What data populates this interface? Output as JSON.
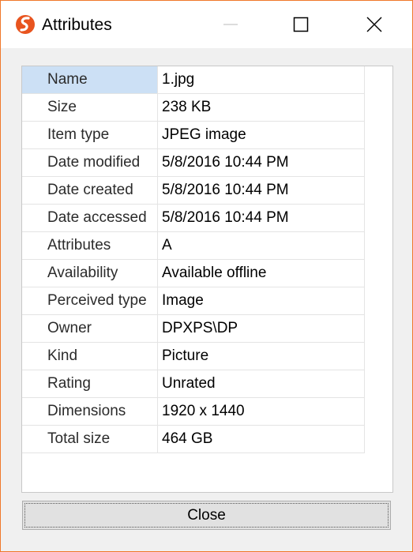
{
  "window": {
    "title": "Attributes",
    "accent": "#f0782a",
    "icons": {
      "app": "app-logo-icon",
      "minimize": "minimize-icon",
      "maximize": "maximize-icon",
      "close": "close-icon"
    }
  },
  "properties": {
    "rows": [
      {
        "name": "Name",
        "value": "1.jpg",
        "selected": true
      },
      {
        "name": "Size",
        "value": "238 KB"
      },
      {
        "name": "Item type",
        "value": "JPEG image"
      },
      {
        "name": "Date modified",
        "value": "5/8/2016 10:44 PM"
      },
      {
        "name": "Date created",
        "value": "5/8/2016 10:44 PM"
      },
      {
        "name": "Date accessed",
        "value": "5/8/2016 10:44 PM"
      },
      {
        "name": "Attributes",
        "value": "A"
      },
      {
        "name": "Availability",
        "value": "Available offline"
      },
      {
        "name": "Perceived type",
        "value": "Image"
      },
      {
        "name": "Owner",
        "value": "DPXPS\\DP"
      },
      {
        "name": "Kind",
        "value": "Picture"
      },
      {
        "name": "Rating",
        "value": "Unrated"
      },
      {
        "name": "Dimensions",
        "value": "1920 x 1440"
      },
      {
        "name": "Total size",
        "value": "464 GB"
      }
    ]
  },
  "buttons": {
    "close_label": "Close"
  }
}
